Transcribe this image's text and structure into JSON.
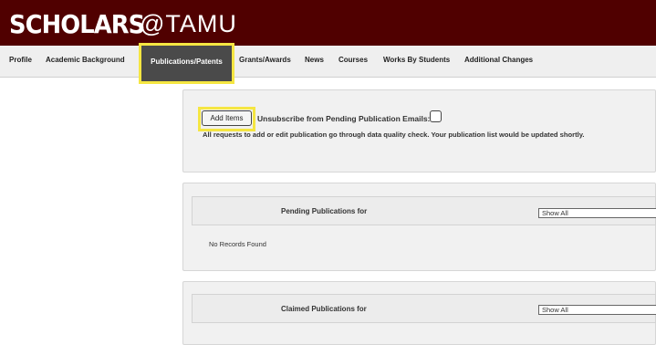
{
  "header": {
    "logo_main": "SCHOLARS",
    "logo_sub": "@TAMU",
    "brand_color": "#500000"
  },
  "nav": {
    "items": [
      {
        "label": "Profile"
      },
      {
        "label": "Academic Background"
      },
      {
        "label": "Publications/Patents",
        "active": true
      },
      {
        "label": "Grants/Awards"
      },
      {
        "label": "News"
      },
      {
        "label": "Courses"
      },
      {
        "label": "Works By Students"
      },
      {
        "label": "Additional Changes"
      }
    ]
  },
  "actions": {
    "add_items_label": "Add Items",
    "unsubscribe_label": "Unsubscribe from Pending Publication Emails:",
    "unsubscribe_checked": false,
    "notice": "All requests to add or edit publication go through data quality check. Your publication list would be updated shortly."
  },
  "pending": {
    "title": "Pending Publications for",
    "filter_value": "Show All",
    "empty_text": "No Records Found"
  },
  "claimed": {
    "title": "Claimed Publications for",
    "filter_value": "Show All"
  },
  "highlight_color": "#f5e642"
}
